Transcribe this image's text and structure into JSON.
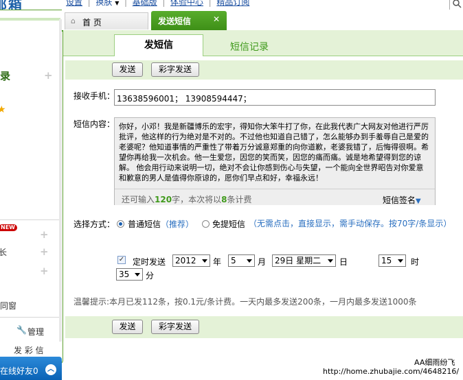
{
  "topbar": {
    "logo_fragment": "邮箱",
    "links": [
      "设置",
      "换肤",
      "基础版",
      "体验中心",
      "精品订阅"
    ]
  },
  "tabs": {
    "home_label": "首 页",
    "active_label": "发送短信"
  },
  "subtabs": {
    "send_label": "发短信",
    "records_label": "短信记录"
  },
  "sidebar": {
    "frag_1": "录",
    "new_badge": "NEW",
    "frag_2": "长",
    "frag_3": "同窗",
    "manage_label": "管理",
    "frag_4": "发 彩 信",
    "online_label": "在线好友0"
  },
  "toolbar": {
    "send_label": "发送",
    "color_send_label": "彩字发送"
  },
  "form": {
    "recipient_label": "接收手机：",
    "recipient_value": "13638596001； 13908594447；",
    "content_label": "短信内容：",
    "content_text": "你好，小邓！我是新疆博乐的宏宇，得知你大笨牛打了你，在此我代表广大网友对他进行严厉批评，他这样的行为绝对是不对的。不过他也知道自己错了，怎么能够办到手羞辱自己是爱的老婆呢？他知道事情的严重性了带着万分诚意郑重的向你道歉，老婆我错了，后悔得很啊。希望你再给我一次机会。他一生爱您，因您的笑而笑，因您的痛而痛。诚是地希望得到您的谅解。  他会用行动来说明一切，绝对不会让你感到伤心与失望，一个能向全世界昭告对你爱意和歉意的男人是值得你原谅的，愿你们早点和好，幸福永远！",
    "counter_prefix": "还可输入",
    "counter_remaining": "120",
    "counter_mid": "字，本次将以",
    "counter_count": "8",
    "counter_suffix": "条计费",
    "signature_label": "短信签名",
    "method_label": "选择方式：",
    "method_normal": "普通短信",
    "method_normal_note": "（推荐）",
    "method_free": "免提短信",
    "method_free_note": "（无需点击，直接显示，需手动保存。按70字/条显示）",
    "method_selected": "normal",
    "scheduled_label": "定时发送",
    "scheduled_checked": true,
    "year": "2012",
    "year_unit": "年",
    "month": "5",
    "month_unit": "月",
    "day": "29日 星期二",
    "day_unit": "日",
    "hour": "15",
    "hour_unit": "时",
    "minute": "35",
    "minute_unit": "分",
    "tip": "温馨提示:本月已发112条，按0.1元/条计费。一天内最多发送200条，一月内最多发送1000条"
  },
  "watermark": {
    "author": "AA细雨纷飞",
    "url": "http://home.zhubajie.com/4648216/"
  },
  "colors": {
    "accent_green": "#3f9a1b",
    "light_green": "#e4f2d7",
    "orange": "#d46a00",
    "new_badge": "#cc0000",
    "online_bar": "#0a72c7"
  }
}
